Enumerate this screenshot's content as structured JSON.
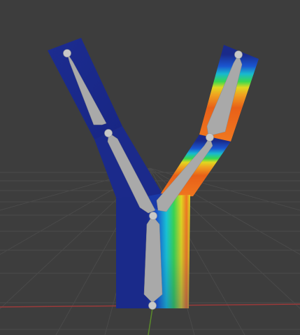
{
  "viewport": {
    "background": "#3d3d3d",
    "grid_color": "#4a4a4a",
    "x_axis_color": "#9a3a3a",
    "y_axis_color": "#5a8a2a"
  },
  "mesh": {
    "shape": "Y",
    "weight_paint_colors": {
      "zero": "#1a2a8a",
      "low": "#1a55d0",
      "cyan": "#18c8d8",
      "green": "#38d850",
      "yellow": "#e0d820",
      "orange": "#f07820",
      "red": "#d83018"
    }
  },
  "armature": {
    "bone_color": "#a9a9a9",
    "joint_color": "#c8c8c8",
    "bones": [
      {
        "name": "trunk-bone"
      },
      {
        "name": "left-upper-bone"
      },
      {
        "name": "left-lower-bone"
      },
      {
        "name": "right-upper-bone"
      },
      {
        "name": "right-lower-bone"
      }
    ]
  }
}
